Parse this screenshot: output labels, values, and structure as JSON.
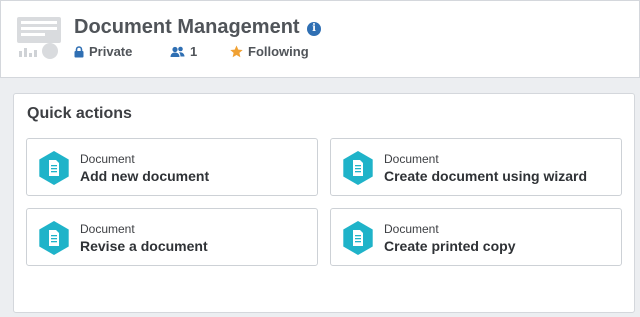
{
  "header": {
    "title": "Document Management",
    "privacy": "Private",
    "members_count": "1",
    "follow_status": "Following"
  },
  "quick_actions": {
    "title": "Quick actions",
    "actions": [
      {
        "type": "Document",
        "label": "Add new document"
      },
      {
        "type": "Document",
        "label": "Create document using wizard"
      },
      {
        "type": "Document",
        "label": "Revise a document"
      },
      {
        "type": "Document",
        "label": "Create printed copy"
      }
    ]
  },
  "colors": {
    "accent_teal": "#1fb3c9",
    "info_blue": "#2f6fb3",
    "star_orange": "#f0a133",
    "meta_icon_blue": "#2f6fb3"
  },
  "icons": {
    "logo": "document-management-logo",
    "info": "info-icon",
    "privacy": "lock-icon",
    "members": "users-icon",
    "follow": "star-icon",
    "action": "document-hexagon-icon"
  }
}
